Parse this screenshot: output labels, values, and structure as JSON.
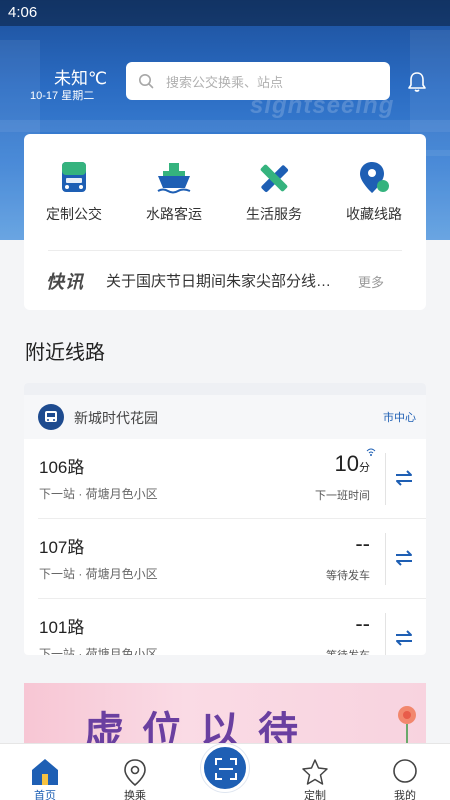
{
  "status_bar": {
    "time": "4:06"
  },
  "weather": {
    "temp": "未知℃",
    "date": "10-17  星期二"
  },
  "search": {
    "placeholder": "搜索公交换乘、站点"
  },
  "quick_actions": [
    {
      "label": "定制公交",
      "icon": "bus-icon"
    },
    {
      "label": "水路客运",
      "icon": "ship-icon"
    },
    {
      "label": "生活服务",
      "icon": "tools-icon"
    },
    {
      "label": "收藏线路",
      "icon": "location-pin-icon"
    }
  ],
  "news": {
    "badge": "快讯",
    "text": "关于国庆节日期间朱家尖部分线路调整的公告",
    "more": "更多"
  },
  "nearby": {
    "title": "附近线路",
    "stop_name": "新城时代花园",
    "stop_region": "市中心",
    "routes": [
      {
        "name": "106路",
        "next": "下一站 · 荷塘月色小区",
        "value": "10",
        "unit": "分",
        "status": "下一班时间"
      },
      {
        "name": "107路",
        "next": "下一站 · 荷塘月色小区",
        "value": "--",
        "unit": "",
        "status": "等待发车"
      },
      {
        "name": "101路",
        "next": "下一站 · 荷塘月色小区",
        "value": "--",
        "unit": "",
        "status": "等待发车"
      }
    ]
  },
  "banner": {
    "text": "虚位以待"
  },
  "tabs": [
    {
      "label": "首页"
    },
    {
      "label": "换乘"
    },
    {
      "label": "定制"
    },
    {
      "label": "我的"
    }
  ],
  "colors": {
    "primary": "#1e5fb4",
    "accent_green": "#35b37e",
    "hero_blue": "#2a6bc2"
  }
}
